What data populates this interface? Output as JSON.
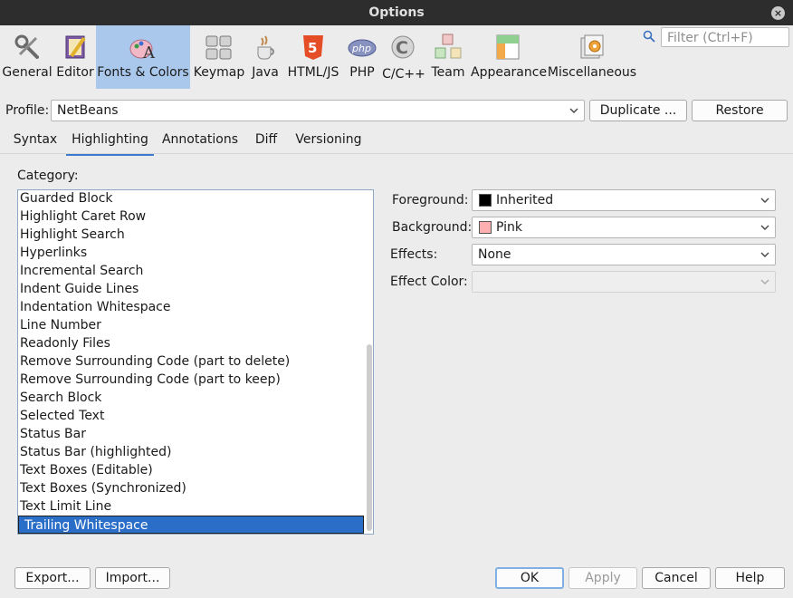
{
  "window": {
    "title": "Options"
  },
  "categories": [
    {
      "label": "General",
      "icon": "wrench-screwdriver-icon"
    },
    {
      "label": "Editor",
      "icon": "pencil-notebook-icon"
    },
    {
      "label": "Fonts & Colors",
      "icon": "fonts-palette-icon"
    },
    {
      "label": "Keymap",
      "icon": "keyboard-icon"
    },
    {
      "label": "Java",
      "icon": "java-cup-icon"
    },
    {
      "label": "HTML/JS",
      "icon": "html5-shield-icon"
    },
    {
      "label": "PHP",
      "icon": "php-icon"
    },
    {
      "label": "C/C++",
      "icon": "c-cpp-icon"
    },
    {
      "label": "Team",
      "icon": "team-cubes-icon"
    },
    {
      "label": "Appearance",
      "icon": "appearance-layout-icon"
    },
    {
      "label": "Miscellaneous",
      "icon": "misc-gears-icon"
    }
  ],
  "filter": {
    "placeholder": "Filter (Ctrl+F)"
  },
  "profile": {
    "label": "Profile:",
    "value": "NetBeans",
    "duplicate_label": "Duplicate ...",
    "restore_label": "Restore"
  },
  "tabs": [
    "Syntax",
    "Highlighting",
    "Annotations",
    "Diff",
    "Versioning"
  ],
  "active_tab": "Highlighting",
  "category_label": "Category:",
  "category_items": [
    "Guarded Block",
    "Highlight Caret Row",
    "Highlight Search",
    "Hyperlinks",
    "Incremental Search",
    "Indent Guide Lines",
    "Indentation Whitespace",
    "Line Number",
    "Readonly Files",
    "Remove Surrounding Code (part to delete)",
    "Remove Surrounding Code (part to keep)",
    "Search Block",
    "Selected Text",
    "Status Bar",
    "Status Bar (highlighted)",
    "Text Boxes (Editable)",
    "Text Boxes (Synchronized)",
    "Text Limit Line",
    "Trailing Whitespace"
  ],
  "selected_item": "Trailing Whitespace",
  "properties": {
    "foreground_label": "Foreground:",
    "foreground_value": "Inherited",
    "foreground_swatch": "#000000",
    "background_label": "Background:",
    "background_value": "Pink",
    "background_swatch": "#ffafaf",
    "effects_label": "Effects:",
    "effects_value": "None",
    "effect_color_label": "Effect Color:",
    "effect_color_value": ""
  },
  "footer": {
    "export_label": "Export...",
    "import_label": "Import...",
    "ok_label": "OK",
    "apply_label": "Apply",
    "cancel_label": "Cancel",
    "help_label": "Help"
  },
  "colors": {
    "accent": "#2b6ec8",
    "active_category": "#aac8ec"
  }
}
